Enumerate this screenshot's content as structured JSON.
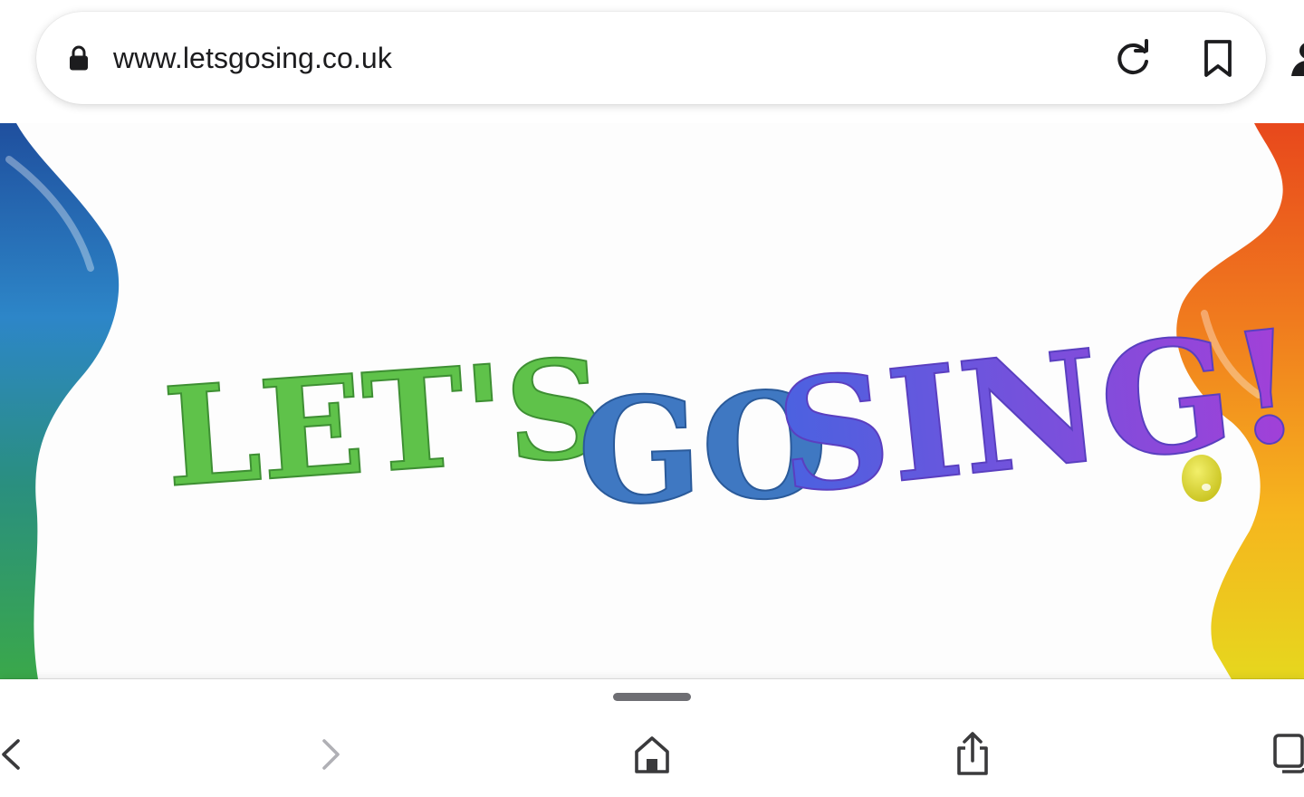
{
  "address_bar": {
    "url": "www.letsgosing.co.uk",
    "lock_icon": "lock-icon",
    "reload_icon": "reload-icon",
    "bookmark_icon": "bookmark-icon",
    "profile_icon": "person-icon"
  },
  "hero": {
    "title_words": [
      "LET'S",
      "GO",
      "SING!"
    ],
    "colors": {
      "let": "#5fc24a",
      "s": "#4e9e9a",
      "go": "#3f78c2",
      "sing_start": "#4a62e0",
      "sing_end": "#a43fd8",
      "left_paint": "#2a6fb8",
      "right_paint": "#f07a1e"
    }
  },
  "toolbar": {
    "back_icon": "chevron-left-icon",
    "forward_icon": "chevron-right-icon",
    "home_icon": "home-icon",
    "share_icon": "share-icon",
    "tabs_icon": "tabs-icon"
  }
}
